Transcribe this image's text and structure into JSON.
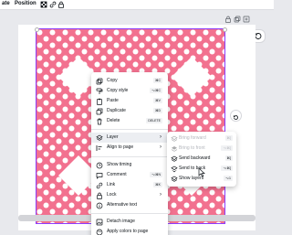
{
  "toolbar": {
    "edit_label": "ate",
    "position_label": "Position"
  },
  "context_menu": {
    "items": [
      {
        "label": "Copy",
        "shortcut": "⌘C",
        "icon": "copy-icon"
      },
      {
        "label": "Copy style",
        "shortcut": "⌥⌘C",
        "icon": "paint-roller-icon"
      },
      {
        "label": "Paste",
        "shortcut": "⌘V",
        "icon": "clipboard-icon"
      },
      {
        "label": "Duplicate",
        "shortcut": "⌘D",
        "icon": "duplicate-icon"
      },
      {
        "label": "Delete",
        "shortcut": "DELETE",
        "icon": "trash-icon"
      },
      {
        "label": "Layer",
        "icon": "layers-icon"
      },
      {
        "label": "Align to page",
        "icon": "align-icon"
      },
      {
        "label": "Show timing",
        "icon": "clock-icon"
      },
      {
        "label": "Comment",
        "shortcut": "⌥⌘N",
        "icon": "comment-icon"
      },
      {
        "label": "Link",
        "shortcut": "⌘K",
        "icon": "link-icon"
      },
      {
        "label": "Lock",
        "icon": "lock-icon"
      },
      {
        "label": "Alternative text",
        "icon": "info-icon"
      },
      {
        "label": "Detach image",
        "icon": "detach-icon"
      },
      {
        "label": "Apply colors to page",
        "icon": "palette-icon"
      }
    ]
  },
  "layer_submenu": {
    "items": [
      {
        "label": "Bring forward",
        "shortcut": "⌘]",
        "disabled": true,
        "icon": "bring-forward-icon"
      },
      {
        "label": "Bring to front",
        "shortcut": "⌥⌘]",
        "disabled": true,
        "icon": "bring-to-front-icon"
      },
      {
        "label": "Send backward",
        "shortcut": "⌘[",
        "disabled": false,
        "icon": "send-backward-icon"
      },
      {
        "label": "Send to back",
        "shortcut": "⌥⌘[",
        "disabled": false,
        "icon": "send-to-back-icon"
      },
      {
        "label": "Show layers",
        "shortcut": "⌥1",
        "disabled": false,
        "icon": "show-layers-icon"
      }
    ]
  },
  "colors": {
    "pattern_pink": "#f2718f",
    "selection_purple": "#8b3dff"
  }
}
